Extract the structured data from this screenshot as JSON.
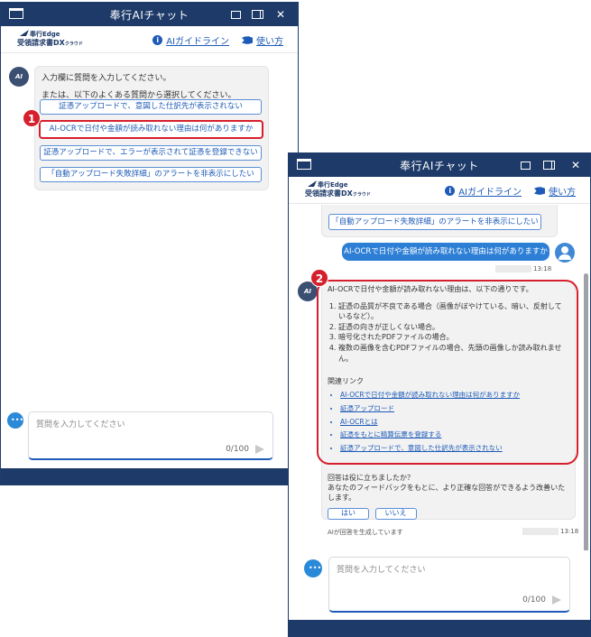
{
  "window": {
    "title": "奉行AIチャット",
    "logo_line1": "奉行Edge",
    "logo_line2": "受領請求書DX",
    "logo_line2_suffix": "クラウド"
  },
  "header_links": [
    {
      "label": "AIガイドライン",
      "icon": "info-icon"
    },
    {
      "label": "使い方",
      "icon": "book-icon"
    }
  ],
  "intro": {
    "line1": "入力欄に質問を入力してください。",
    "line2": "または、以下のよくある質問から選択してください。"
  },
  "faq": [
    "証憑アップロードで、意図した仕訳先が表示されない",
    "AI-OCRで日付や金額が読み取れない理由は何がありますか",
    "証憑アップロードで、エラーが表示されて証憑を登録できない",
    "「自動アップロード失敗詳細」のアラートを非表示にしたい"
  ],
  "badges": [
    "1",
    "2"
  ],
  "bot_avatar_label": "AI",
  "user_message": "AI-OCRで日付や金額が読み取れない理由は何がありますか",
  "timestamps": [
    "13:18",
    "13:18"
  ],
  "answer": {
    "intro": "AI-OCRで日付や金額が読み取れない理由は、以下の通りです。",
    "reasons": [
      "証憑の品質が不良である場合（画像がぼやけている、暗い、反射しているなど）。",
      "証憑の向きが正しくない場合。",
      "暗号化されたPDFファイルの場合。",
      "複数の画像を含むPDFファイルの場合、先頭の画像しか読み取れません。"
    ],
    "related_heading": "関連リンク",
    "related_links": [
      "AI-OCRで日付や金額が読み取れない理由は何がありますか",
      "証憑アップロード",
      "AI-OCRとは",
      "証憑をもとに精算伝票を登録する",
      "証憑アップロードで、意図した仕訳先が表示されない"
    ]
  },
  "feedback": {
    "question": "回答は役に立ちましたか？",
    "description": "あなたのフィードバックをもとに、より正確な回答ができるよう改善いたします。",
    "yes": "はい",
    "no": "いいえ"
  },
  "ai_note": "AIが回答を生成しています",
  "input": {
    "placeholder": "質問を入力してください",
    "counter": "0/100"
  },
  "colors": {
    "titlebar": "#1d3a68",
    "accent": "#1e5bb8",
    "highlight": "#d61f2c"
  }
}
